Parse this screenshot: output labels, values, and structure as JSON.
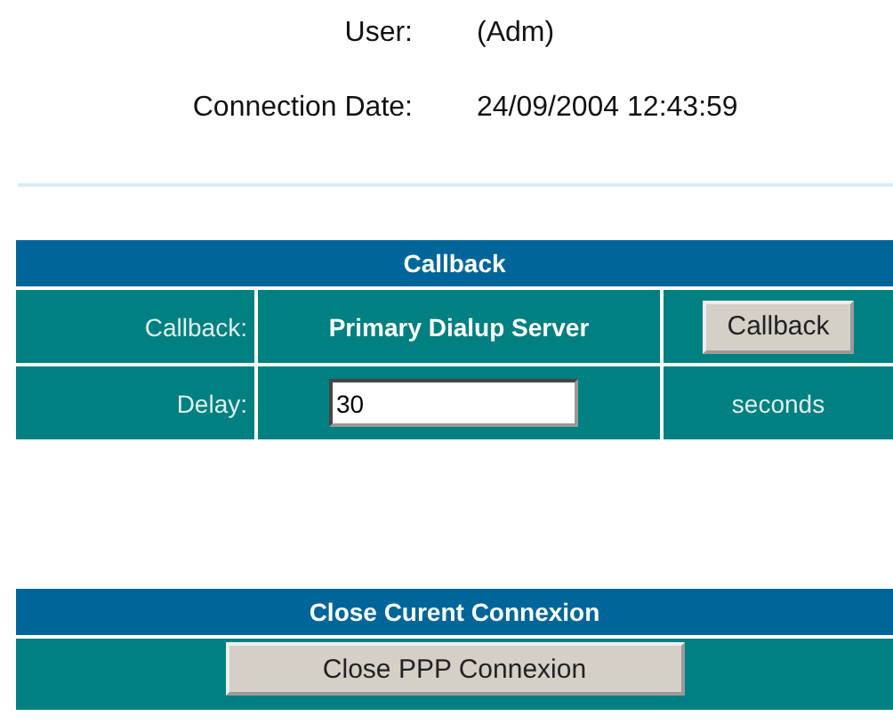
{
  "info": [
    {
      "label": "User:",
      "value": "(Adm)"
    },
    {
      "label": "Connection Date:",
      "value": "24/09/2004 12:43:59"
    }
  ],
  "callback": {
    "title": "Callback",
    "row_label": "Callback:",
    "server": "Primary Dialup Server",
    "button": "Callback",
    "delay_label": "Delay:",
    "delay_value": "30",
    "delay_unit": "seconds"
  },
  "close": {
    "title": "Close Curent Connexion",
    "button": "Close PPP Connexion"
  }
}
